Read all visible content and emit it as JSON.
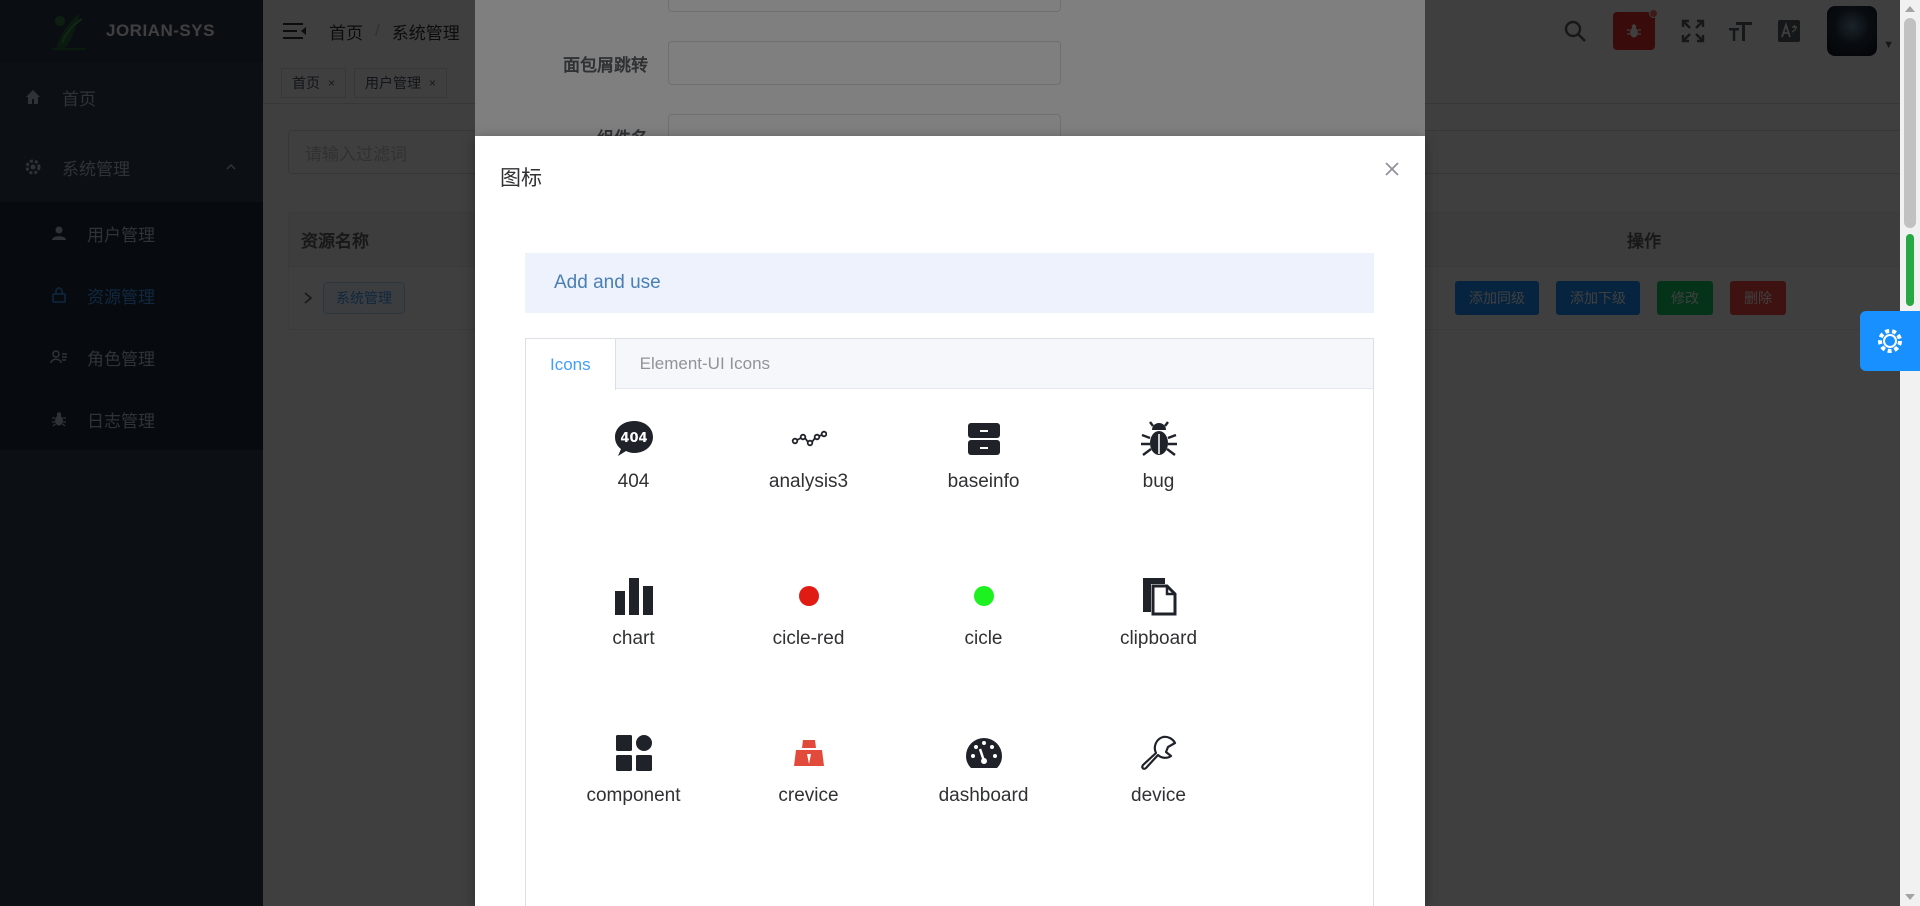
{
  "sidebar": {
    "logo_text": "JORIAN-SYS",
    "items": [
      {
        "label": "首页",
        "icon": "home-icon"
      },
      {
        "label": "系统管理",
        "icon": "gear-icon"
      }
    ],
    "subitems": [
      {
        "label": "用户管理",
        "icon": "user-icon"
      },
      {
        "label": "资源管理",
        "icon": "lock-icon"
      },
      {
        "label": "角色管理",
        "icon": "role-icon"
      },
      {
        "label": "日志管理",
        "icon": "bug-icon"
      }
    ],
    "colors": {
      "bg": "#304156",
      "active": "#409eff"
    }
  },
  "header": {
    "breadcrumb": [
      "首页",
      "系统管理"
    ],
    "breadcrumb_sep": "/"
  },
  "tags": [
    {
      "label": "首页"
    },
    {
      "label": "用户管理"
    }
  ],
  "main": {
    "filter_placeholder": "请输入过滤词",
    "table": {
      "col_name": "资源名称",
      "col_ops": "操作",
      "row_tag": "系统管理",
      "ops": [
        "添加同级",
        "添加下级",
        "修改",
        "删除"
      ]
    }
  },
  "back_dialog": {
    "fields": [
      {
        "label": ""
      },
      {
        "label": "面包屑跳转"
      },
      {
        "label": "组件名"
      }
    ]
  },
  "modal": {
    "title": "图标",
    "alert": "Add and use",
    "tabs": [
      "Icons",
      "Element-UI Icons"
    ],
    "icons": [
      {
        "label": "404",
        "icon": "404-icon"
      },
      {
        "label": "analysis3",
        "icon": "analysis-icon"
      },
      {
        "label": "baseinfo",
        "icon": "baseinfo-icon"
      },
      {
        "label": "bug",
        "icon": "bug-icon"
      },
      {
        "label": "chart",
        "icon": "chart-icon"
      },
      {
        "label": "cicle-red",
        "icon": "circle-red-icon"
      },
      {
        "label": "cicle",
        "icon": "circle-green-icon"
      },
      {
        "label": "clipboard",
        "icon": "clipboard-icon"
      },
      {
        "label": "component",
        "icon": "component-icon"
      },
      {
        "label": "crevice",
        "icon": "crevice-icon"
      },
      {
        "label": "dashboard",
        "icon": "dashboard-icon"
      },
      {
        "label": "device",
        "icon": "wrench-icon"
      }
    ]
  }
}
